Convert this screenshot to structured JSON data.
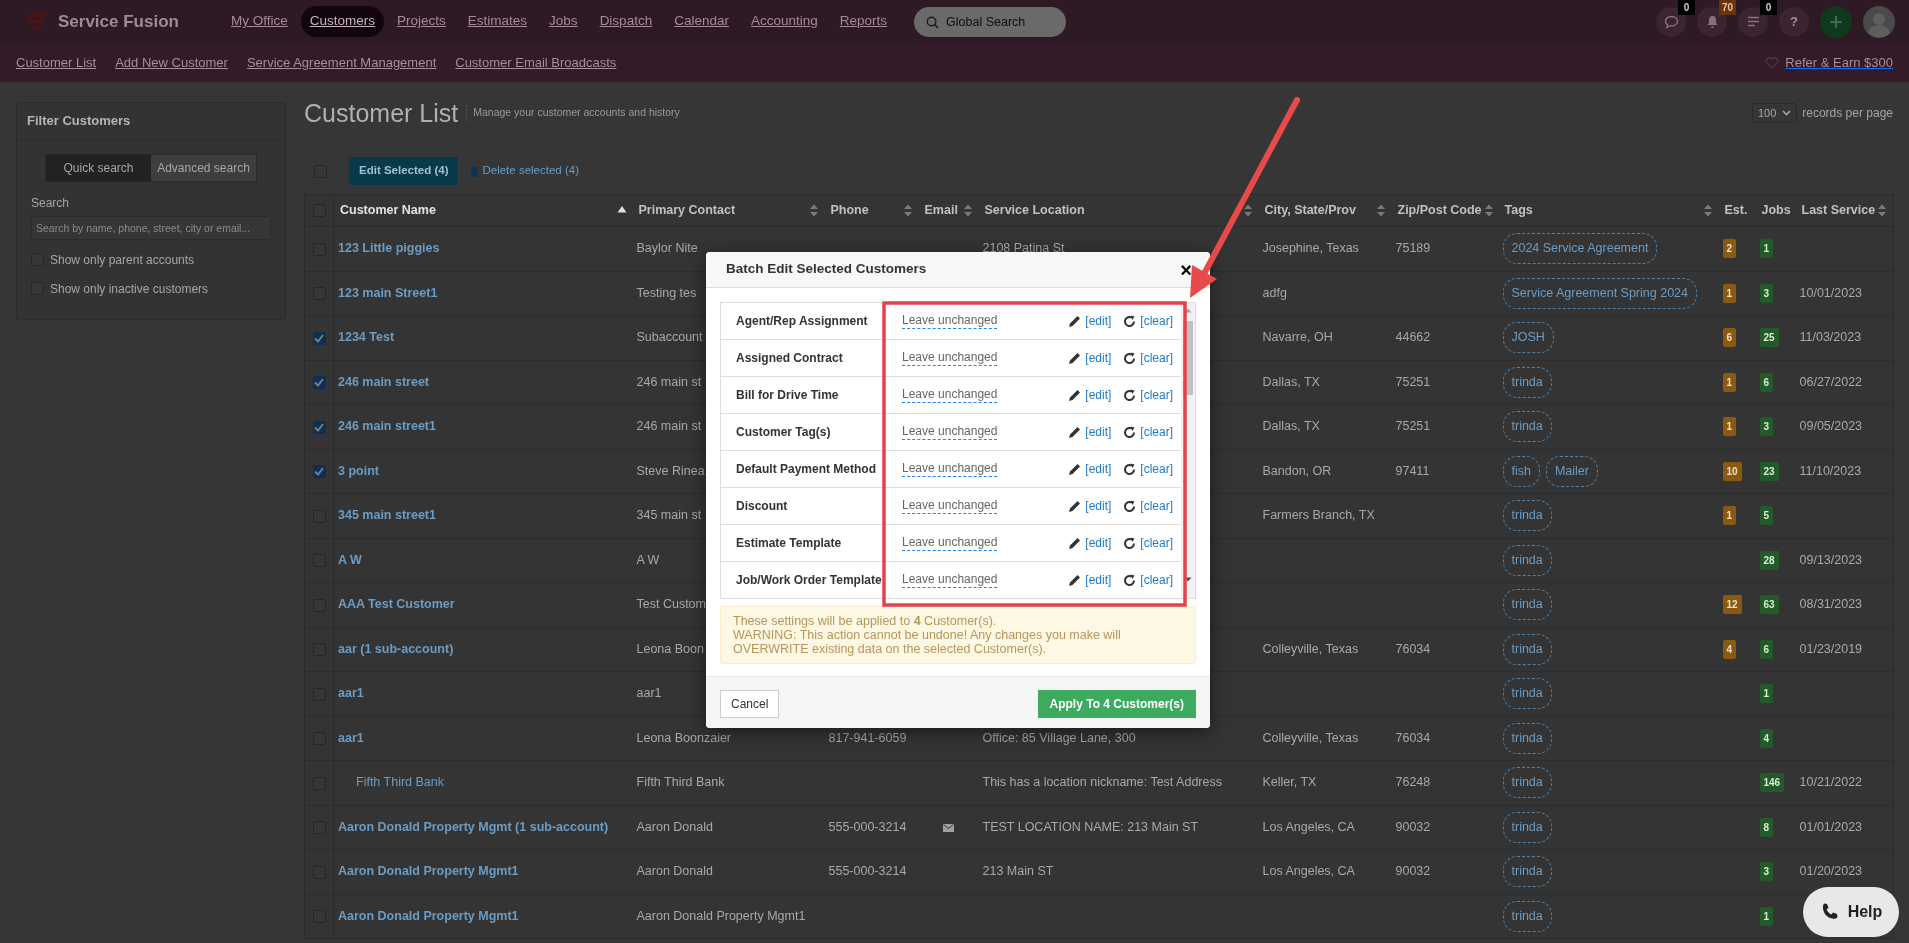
{
  "app": {
    "logo": "Service Fusion"
  },
  "main_nav": [
    {
      "label": "My Office",
      "selected": false
    },
    {
      "label": "Customers",
      "selected": true
    },
    {
      "label": "Projects",
      "selected": false
    },
    {
      "label": "Estimates",
      "selected": false
    },
    {
      "label": "Jobs",
      "selected": false
    },
    {
      "label": "Dispatch",
      "selected": false
    },
    {
      "label": "Calendar",
      "selected": false
    },
    {
      "label": "Accounting",
      "selected": false
    },
    {
      "label": "Reports",
      "selected": false
    }
  ],
  "global_search": {
    "placeholder": "Global Search"
  },
  "header_icons": [
    {
      "kind": "chat",
      "badge": "0"
    },
    {
      "kind": "bell",
      "badge": "70"
    },
    {
      "kind": "list",
      "badge": "0"
    },
    {
      "kind": "help",
      "label": "?"
    },
    {
      "kind": "add"
    },
    {
      "kind": "avatar"
    }
  ],
  "sub_nav": [
    "Customer List",
    "Add New Customer",
    "Service Agreement Management",
    "Customer Email Broadcasts"
  ],
  "refer": "Refer & Earn $300",
  "filter_panel": {
    "title": "Filter Customers",
    "modes": [
      {
        "label": "Quick search",
        "selected": true
      },
      {
        "label": "Advanced search",
        "selected": false
      }
    ],
    "search_label": "Search",
    "search_placeholder": "Search by name, phone, street, city or email...",
    "options": [
      {
        "label": "Show only parent accounts",
        "checked": false
      },
      {
        "label": "Show only inactive customers",
        "checked": false
      }
    ]
  },
  "page": {
    "title": "Customer List",
    "subtitle": "Manage your customer accounts and history",
    "per_page": "100",
    "per_page_label": "records per page"
  },
  "toolbar": {
    "select_all_checked": false,
    "edit_button": "Edit Selected (4)",
    "delete_link": "Delete selected (4)"
  },
  "table": {
    "header_checked": false,
    "columns": [
      {
        "label": "Customer Name",
        "sortable": true,
        "sorted": true
      },
      {
        "label": "Primary Contact",
        "sortable": true,
        "sorted": false
      },
      {
        "label": "Phone",
        "sortable": true,
        "sorted": false
      },
      {
        "label": "Email",
        "sortable": true,
        "sorted": false
      },
      {
        "label": "Service Location",
        "sortable": true,
        "sorted": false
      },
      {
        "label": "City, State/Prov",
        "sortable": true,
        "sorted": false
      },
      {
        "label": "Zip/Post Code",
        "sortable": true,
        "sorted": false
      },
      {
        "label": "Tags",
        "sortable": true,
        "sorted": false
      },
      {
        "label": "Est.",
        "sortable": false,
        "sorted": false
      },
      {
        "label": "Jobs",
        "sortable": false,
        "sorted": false
      },
      {
        "label": "Last Service",
        "sortable": true,
        "sorted": false
      }
    ],
    "rows": [
      {
        "kind": "account",
        "checked": false,
        "has_email": false,
        "name": "123 Little piggies",
        "contact": "Baylor Nite",
        "service_location": "2108 Patina St",
        "city": "Josephine, Texas",
        "zip": "75189",
        "tags": [
          "2024 Service Agreement"
        ],
        "est": "2",
        "jobs": "1"
      },
      {
        "kind": "account",
        "checked": false,
        "name": "123 main Street1",
        "contact": "Testing tes",
        "city": "adfg",
        "tags": [
          "Service Agreement Spring 2024"
        ],
        "est": "1",
        "jobs": "3",
        "last_service": "10/01/2023"
      },
      {
        "kind": "account",
        "checked": true,
        "name": "1234 Test",
        "contact": "Subaccount",
        "city": "Navarre, OH",
        "zip": "44662",
        "tags": [
          "JOSH"
        ],
        "est": "6",
        "jobs": "25",
        "last_service": "11/03/2023"
      },
      {
        "kind": "account",
        "checked": true,
        "name": "246 main street",
        "contact": "246 main st",
        "city": "Dallas, TX",
        "zip": "75251",
        "tags": [
          "trinda"
        ],
        "est": "1",
        "jobs": "6",
        "last_service": "06/27/2022"
      },
      {
        "kind": "account",
        "checked": true,
        "name": "246 main street1",
        "contact": "246 main st",
        "city": "Dallas, TX",
        "zip": "75251",
        "tags": [
          "trinda"
        ],
        "est": "1",
        "jobs": "3",
        "last_service": "09/05/2023"
      },
      {
        "kind": "account",
        "checked": true,
        "name": "3 point",
        "contact": "Steve Rinea",
        "city": "Bandon, OR",
        "zip": "97411",
        "tags": [
          "fish",
          "Mailer"
        ],
        "est": "10",
        "jobs": "23",
        "last_service": "11/10/2023"
      },
      {
        "kind": "account",
        "checked": false,
        "name": "345 main street1",
        "contact": "345 main st",
        "city": "Farmers Branch, TX",
        "tags": [
          "trinda"
        ],
        "est": "1",
        "jobs": "5"
      },
      {
        "kind": "account",
        "checked": false,
        "name": "A W",
        "contact": "A W",
        "tags": [
          "trinda"
        ],
        "jobs": "28",
        "last_service": "09/13/2023"
      },
      {
        "kind": "account",
        "checked": false,
        "name": "AAA Test Customer",
        "contact": "Test Custom",
        "tags": [
          "trinda"
        ],
        "est": "12",
        "jobs": "63",
        "last_service": "08/31/2023"
      },
      {
        "kind": "account",
        "checked": false,
        "name": "aar (1 sub-account)",
        "contact": "Leona Boon",
        "city": "Colleyville, Texas",
        "zip": "76034",
        "tags": [
          "trinda"
        ],
        "est": "4",
        "jobs": "6",
        "last_service": "01/23/2019"
      },
      {
        "kind": "account",
        "checked": false,
        "name": "aar1",
        "contact": "aar1",
        "tags": [
          "trinda"
        ],
        "jobs": "1"
      },
      {
        "kind": "account",
        "checked": false,
        "has_email": false,
        "name": "aar1",
        "contact": "Leona Boonzaier",
        "phone": "817-941-6059",
        "service_location": "Office: 85 Village Lane, 300",
        "city": "Colleyville, Texas",
        "zip": "76034",
        "tags": [
          "trinda"
        ],
        "jobs": "4"
      },
      {
        "kind": "sub_account",
        "checked": false,
        "has_email": false,
        "name": "Fifth Third Bank",
        "contact": "Fifth Third Bank",
        "service_location": "This has a location nickname: Test Address",
        "city": "Keller, TX",
        "zip": "76248",
        "tags": [
          "trinda"
        ],
        "jobs": "146",
        "last_service": "10/21/2022"
      },
      {
        "kind": "account",
        "checked": false,
        "has_email": true,
        "name": "Aaron Donald Property Mgmt (1 sub-account)",
        "contact": "Aaron Donald",
        "phone": "555-000-3214",
        "service_location": "TEST LOCATION NAME: 213 Main ST",
        "city": "Los Angeles, CA",
        "zip": "90032",
        "tags": [
          "trinda"
        ],
        "jobs": "8",
        "last_service": "01/01/2023"
      },
      {
        "kind": "account",
        "checked": false,
        "has_email": false,
        "name": "Aaron Donald Property Mgmt1",
        "contact": "Aaron Donald",
        "phone": "555-000-3214",
        "service_location": "213 Main ST",
        "city": "Los Angeles, CA",
        "zip": "90032",
        "tags": [
          "trinda"
        ],
        "jobs": "3",
        "last_service": "01/20/2023"
      },
      {
        "kind": "account",
        "checked": false,
        "has_email": false,
        "name": "Aaron Donald Property Mgmt1",
        "contact": "Aaron Donald Property Mgmt1",
        "tags": [
          "trinda"
        ],
        "jobs": "1"
      }
    ]
  },
  "modal": {
    "title": "Batch Edit Selected Customers",
    "close": "×",
    "fields": [
      {
        "label": "Agent/Rep Assignment",
        "value": "Leave unchanged",
        "edit": "[edit]",
        "clear": "[clear]"
      },
      {
        "label": "Assigned Contract",
        "value": "Leave unchanged",
        "edit": "[edit]",
        "clear": "[clear]"
      },
      {
        "label": "Bill for Drive Time",
        "value": "Leave unchanged",
        "edit": "[edit]",
        "clear": "[clear]"
      },
      {
        "label": "Customer Tag(s)",
        "value": "Leave unchanged",
        "edit": "[edit]",
        "clear": "[clear]"
      },
      {
        "label": "Default Payment Method",
        "value": "Leave unchanged",
        "edit": "[edit]",
        "clear": "[clear]"
      },
      {
        "label": "Discount",
        "value": "Leave unchanged",
        "edit": "[edit]",
        "clear": "[clear]"
      },
      {
        "label": "Estimate Template",
        "value": "Leave unchanged",
        "edit": "[edit]",
        "clear": "[clear]"
      },
      {
        "label": "Job/Work Order Template",
        "value": "Leave unchanged",
        "edit": "[edit]",
        "clear": "[clear]"
      }
    ],
    "notice": "These settings will be applied to **4** Customer(s).",
    "warning": "WARNING: This action cannot be undone! Any changes you make will OVERWRITE existing data on the selected Customer(s).",
    "cancel": "Cancel",
    "apply": "Apply To 4 Customer(s)"
  },
  "help_button": {
    "label": "Help"
  }
}
